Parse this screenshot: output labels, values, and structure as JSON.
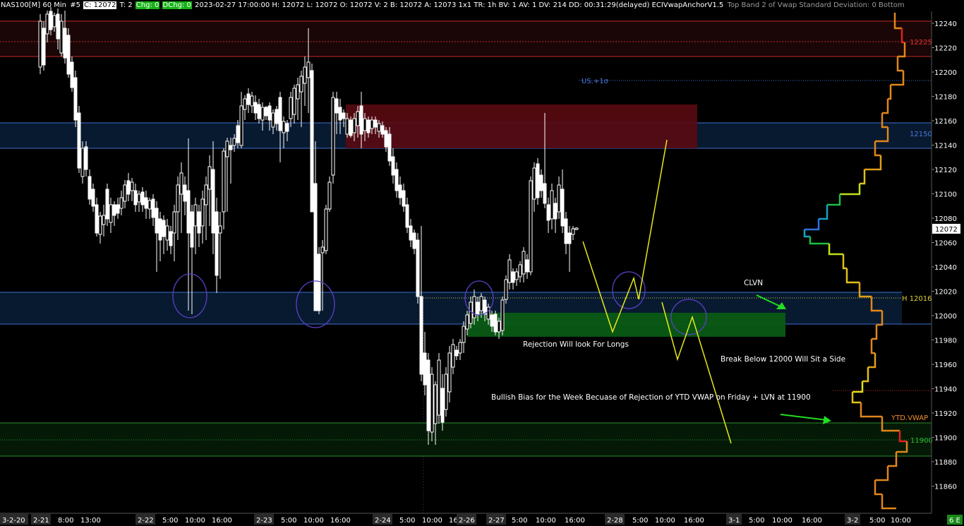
{
  "title_bar": {
    "symbol": "NAS100[M]  60 Min",
    "bars_field": "#5",
    "close_field": "C: 12072",
    "ticks_field": "T: 2",
    "chg_label": "Chg: 0",
    "dchg_label": "DChg: 0",
    "details": "2023-02-27 17:00:00 H: 12072 L: 12072 O: 12072 V: 2 B: 12072 A: 12073 1x1 TR: 1h BV: 1 AV: 1 DV: 214 DD: 00:31:29(delayed) ECIVwapAnchorV1.5",
    "study": "Top Band 2 of Vwap Standard Deviation: 0  Bottom"
  },
  "price_axis": {
    "ticks": [
      "12240",
      "12220",
      "12200",
      "12180",
      "12160",
      "12140",
      "12120",
      "12100",
      "12080",
      "12060",
      "12040",
      "12020",
      "12000",
      "11980",
      "11960",
      "11940",
      "11920",
      "11900",
      "11880",
      "11860"
    ],
    "current_price": "12072"
  },
  "time_axis": {
    "labels": [
      "3-2-20",
      "2-21",
      "8:00",
      "13:00",
      "2-22",
      "5:00",
      "10:00",
      "16:00",
      "2-23",
      "5:00",
      "10:00",
      "16:00",
      "2-24",
      "5:00",
      "10:00",
      "16:00",
      "2-26",
      "2-27",
      "5:00",
      "10:00",
      "16:00",
      "2-28",
      "5:00",
      "10:00",
      "16:00",
      "3-1",
      "5:00",
      "10:00",
      "16:00",
      "3-2",
      "5:00",
      "10:00"
    ],
    "corner_badge": "6 E"
  },
  "levels": {
    "label_12225": "12225",
    "label_12150": "12150",
    "label_us1": "US.+1σ",
    "label_h": "H 12016",
    "label_ytd": "YTD.VWAP",
    "label_11900": "11900"
  },
  "annotations": {
    "clvn": "CLVN",
    "rejection": "Rejection Will look For Longs",
    "break_below": "Break Below 12000 Will Sit a Side",
    "bias": "Bullish Bias for the Week Becuase of Rejection of YTD VWAP on Friday + LVN at 11900"
  },
  "colors": {
    "background": "#000000",
    "candle_body": "#ffffff",
    "band_blue": "#3d6fd0",
    "band_red": "#c62828",
    "supply_zone": "#5a0a12",
    "demand_zone": "#0a5a14",
    "projection": "#e8e81a",
    "arrow": "#22dd22",
    "circle": "#5b3fc8"
  }
}
